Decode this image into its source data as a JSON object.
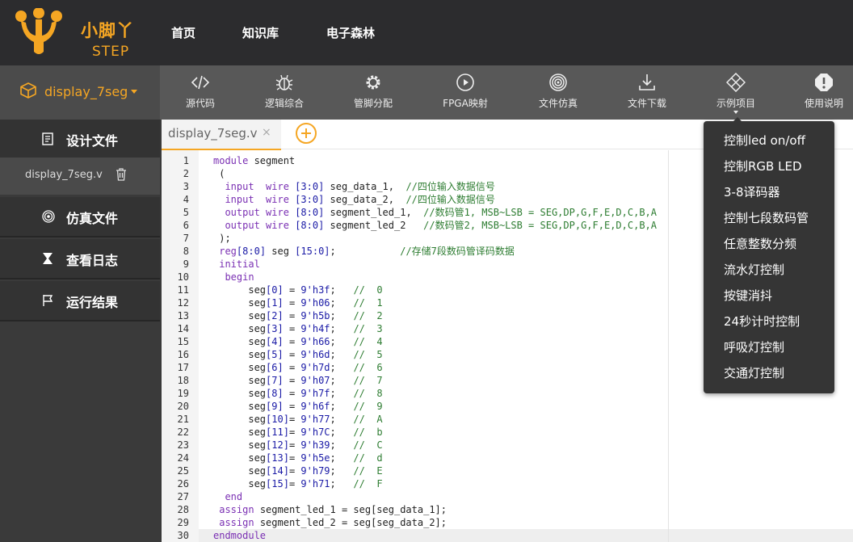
{
  "header": {
    "brand": "小脚丫",
    "brand_sub": "STEP",
    "nav": [
      "首页",
      "知识库",
      "电子森林"
    ]
  },
  "project": {
    "name": "display_7seg"
  },
  "toolbar": [
    {
      "label": "源代码",
      "icon": "code-icon"
    },
    {
      "label": "逻辑综合",
      "icon": "bug-icon"
    },
    {
      "label": "管脚分配",
      "icon": "gear-icon"
    },
    {
      "label": "FPGA映射",
      "icon": "play-icon"
    },
    {
      "label": "文件仿真",
      "icon": "target-icon"
    },
    {
      "label": "文件下载",
      "icon": "download-icon"
    },
    {
      "label": "示例项目",
      "icon": "diamond-icon"
    },
    {
      "label": "使用说明",
      "icon": "alert-icon"
    }
  ],
  "sidebar": {
    "design_files": "设计文件",
    "file": "display_7seg.v",
    "sim_files": "仿真文件",
    "logs": "查看日志",
    "results": "运行结果"
  },
  "editor": {
    "tab": "display_7seg.v",
    "close": "×",
    "lines": [
      "module segment",
      " (",
      "  input  wire [3:0] seg_data_1,  //四位输入数据信号",
      "  input  wire [3:0] seg_data_2,  //四位输入数据信号",
      "  output wire [8:0] segment_led_1,  //数码管1, MSB~LSB = SEG,DP,G,F,E,D,C,B,A",
      "  output wire [8:0] segment_led_2   //数码管2, MSB~LSB = SEG,DP,G,F,E,D,C,B,A",
      " );",
      " reg[8:0] seg [15:0];           //存储7段数码管译码数据",
      " initial",
      "  begin",
      "      seg[0] = 9'h3f;   //  0",
      "      seg[1] = 9'h06;   //  1",
      "      seg[2] = 9'h5b;   //  2",
      "      seg[3] = 9'h4f;   //  3",
      "      seg[4] = 9'h66;   //  4",
      "      seg[5] = 9'h6d;   //  5",
      "      seg[6] = 9'h7d;   //  6",
      "      seg[7] = 9'h07;   //  7",
      "      seg[8] = 9'h7f;   //  8",
      "      seg[9] = 9'h6f;   //  9",
      "      seg[10]= 9'h77;   //  A",
      "      seg[11]= 9'h7C;   //  b",
      "      seg[12]= 9'h39;   //  C",
      "      seg[13]= 9'h5e;   //  d",
      "      seg[14]= 9'h79;   //  E",
      "      seg[15]= 9'h71;   //  F",
      "  end",
      " assign segment_led_1 = seg[seg_data_1];",
      " assign segment_led_2 = seg[seg_data_2];",
      "endmodule"
    ],
    "active_line": 30
  },
  "examples_menu": [
    "控制led on/off",
    "控制RGB LED",
    "3-8译码器",
    "控制七段数码管",
    "任意整数分频",
    "流水灯控制",
    "按键消抖",
    "24秒计时控制",
    "呼吸灯控制",
    "交通灯控制"
  ],
  "colors": {
    "accent": "#f5a623",
    "topbar": "#2c2c2e",
    "toolbar": "#585858"
  }
}
